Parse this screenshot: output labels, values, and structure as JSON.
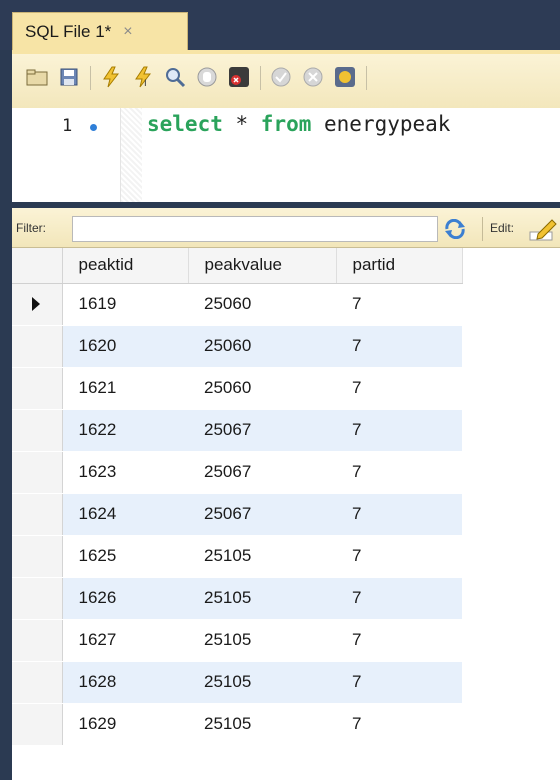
{
  "tab": {
    "title": "SQL File 1*",
    "close_glyph": "×"
  },
  "toolbar": {
    "buttons": [
      "open-folder-icon",
      "save-icon",
      "execute-icon",
      "execute-current-icon",
      "explain-icon",
      "stop-icon",
      "toggle-error-icon",
      "commit-icon",
      "rollback-icon",
      "autocommit-icon"
    ]
  },
  "editor": {
    "line_number": "1",
    "code": {
      "kw1": "select",
      "mid1": " * ",
      "kw2": "from",
      "rest": " energypeak"
    }
  },
  "filterbar": {
    "filter_label": "Filter:",
    "filter_value": "",
    "edit_label": "Edit:"
  },
  "grid": {
    "columns": [
      "peaktid",
      "peakvalue",
      "partid"
    ],
    "rows": [
      [
        "1619",
        "25060",
        "7"
      ],
      [
        "1620",
        "25060",
        "7"
      ],
      [
        "1621",
        "25060",
        "7"
      ],
      [
        "1622",
        "25067",
        "7"
      ],
      [
        "1623",
        "25067",
        "7"
      ],
      [
        "1624",
        "25067",
        "7"
      ],
      [
        "1625",
        "25105",
        "7"
      ],
      [
        "1626",
        "25105",
        "7"
      ],
      [
        "1627",
        "25105",
        "7"
      ],
      [
        "1628",
        "25105",
        "7"
      ],
      [
        "1629",
        "25105",
        "7"
      ]
    ],
    "selected_row": 0
  },
  "colors": {
    "accent_tab": "#f7e4a6",
    "alt_row": "#e7f0fb",
    "keyword": "#2aa35b",
    "line_dot": "#2f7fd8"
  }
}
